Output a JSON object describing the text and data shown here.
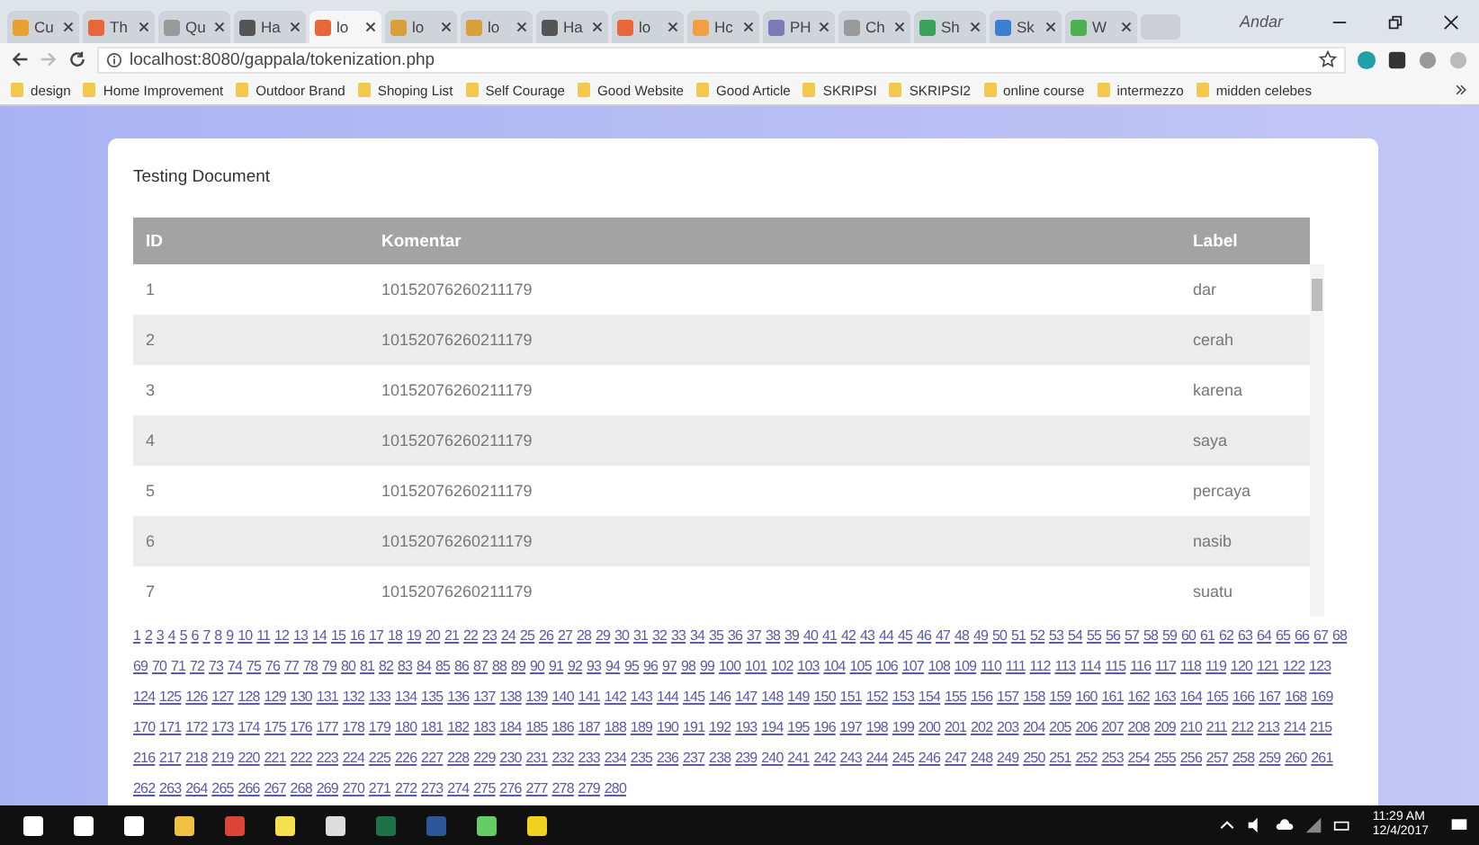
{
  "browser": {
    "user": "Andar",
    "tabs": [
      {
        "title": "Cu",
        "selected": false,
        "color": "#e8a030"
      },
      {
        "title": "Th",
        "selected": false,
        "color": "#e8663a"
      },
      {
        "title": "Qu",
        "selected": false,
        "color": "#9a9a9a"
      },
      {
        "title": "Ha",
        "selected": false,
        "color": "#555555"
      },
      {
        "title": "lo",
        "selected": true,
        "color": "#e8663a"
      },
      {
        "title": "lo",
        "selected": false,
        "color": "#d9a03a"
      },
      {
        "title": "lo",
        "selected": false,
        "color": "#d9a03a"
      },
      {
        "title": "Ha",
        "selected": false,
        "color": "#555555"
      },
      {
        "title": "lo",
        "selected": false,
        "color": "#e8663a"
      },
      {
        "title": "Hc",
        "selected": false,
        "color": "#f0a040"
      },
      {
        "title": "PH",
        "selected": false,
        "color": "#7a7ab8"
      },
      {
        "title": "Ch",
        "selected": false,
        "color": "#9a9a9a"
      },
      {
        "title": "Sh",
        "selected": false,
        "color": "#3aa05a"
      },
      {
        "title": "Sk",
        "selected": false,
        "color": "#3a80d0"
      },
      {
        "title": "W",
        "selected": false,
        "color": "#4caf50"
      }
    ],
    "address": "localhost:8080/gappala/tokenization.php",
    "bookmarks": [
      "design",
      "Home Improvement",
      "Outdoor Brand",
      "Shoping List",
      "Self Courage",
      "Good Website",
      "Good Article",
      "SKRIPSI",
      "SKRIPSI2",
      "online course",
      "intermezzo",
      "midden celebes"
    ]
  },
  "page": {
    "title": "Testing Document",
    "table": {
      "columns": [
        "ID",
        "Komentar",
        "Label"
      ],
      "rows": [
        [
          "1",
          "10152076260211179",
          "dar"
        ],
        [
          "2",
          "10152076260211179",
          "cerah"
        ],
        [
          "3",
          "10152076260211179",
          "karena"
        ],
        [
          "4",
          "10152076260211179",
          "saya"
        ],
        [
          "5",
          "10152076260211179",
          "percaya"
        ],
        [
          "6",
          "10152076260211179",
          "nasib"
        ],
        [
          "7",
          "10152076260211179",
          "suatu"
        ]
      ]
    },
    "pages": [
      "1",
      "2",
      "3",
      "4",
      "5",
      "6",
      "7",
      "8",
      "9",
      "10",
      "11",
      "12",
      "13",
      "14",
      "15",
      "16",
      "17",
      "18",
      "19",
      "20",
      "21",
      "22",
      "23",
      "24",
      "25",
      "26",
      "27",
      "28",
      "29",
      "30",
      "31",
      "32",
      "33",
      "34",
      "35",
      "36",
      "37",
      "38",
      "39",
      "40",
      "41",
      "42",
      "43",
      "44",
      "45",
      "46",
      "47",
      "48",
      "49",
      "50",
      "51",
      "52",
      "53",
      "54",
      "55",
      "56",
      "57",
      "58",
      "59",
      "60",
      "61",
      "62",
      "63",
      "64",
      "65",
      "66",
      "67",
      "68",
      "69",
      "70",
      "71",
      "72",
      "73",
      "74",
      "75",
      "76",
      "77",
      "78",
      "79",
      "80",
      "81",
      "82",
      "83",
      "84",
      "85",
      "86",
      "87",
      "88",
      "89",
      "90",
      "91",
      "92",
      "93",
      "94",
      "95",
      "96",
      "97",
      "98",
      "99",
      "100",
      "101",
      "102",
      "103",
      "104",
      "105",
      "106",
      "107",
      "108",
      "109",
      "110",
      "111",
      "112",
      "113",
      "114",
      "115",
      "116",
      "117",
      "118",
      "119",
      "120",
      "121",
      "122",
      "123",
      "124",
      "125",
      "126",
      "127",
      "128",
      "129",
      "130",
      "131",
      "132",
      "133",
      "134",
      "135",
      "136",
      "137",
      "138",
      "139",
      "140",
      "141",
      "142",
      "143",
      "144",
      "145",
      "146",
      "147",
      "148",
      "149",
      "150",
      "151",
      "152",
      "153",
      "154",
      "155",
      "156",
      "157",
      "158",
      "159",
      "160",
      "161",
      "162",
      "163",
      "164",
      "165",
      "166",
      "167",
      "168",
      "169",
      "170",
      "171",
      "172",
      "173",
      "174",
      "175",
      "176",
      "177",
      "178",
      "179",
      "180",
      "181",
      "182",
      "183",
      "184",
      "185",
      "186",
      "187",
      "188",
      "189",
      "190",
      "191",
      "192",
      "193",
      "194",
      "195",
      "196",
      "197",
      "198",
      "199",
      "200",
      "201",
      "202",
      "203",
      "204",
      "205",
      "206",
      "207",
      "208",
      "209",
      "210",
      "211",
      "212",
      "213",
      "214",
      "215",
      "216",
      "217",
      "218",
      "219",
      "220",
      "221",
      "222",
      "223",
      "224",
      "225",
      "226",
      "227",
      "228",
      "229",
      "230",
      "231",
      "232",
      "233",
      "234",
      "235",
      "236",
      "237",
      "238",
      "239",
      "240",
      "241",
      "242",
      "243",
      "244",
      "245",
      "246",
      "247",
      "248",
      "249",
      "250",
      "251",
      "252",
      "253",
      "254",
      "255",
      "256",
      "257",
      "258",
      "259",
      "260",
      "261",
      "262",
      "263",
      "264",
      "265",
      "266",
      "267",
      "268",
      "269",
      "270",
      "271",
      "272",
      "273",
      "274",
      "275",
      "276",
      "277",
      "278",
      "279",
      "280"
    ]
  },
  "taskbar": {
    "time": "11:29 AM",
    "date": "12/4/2017"
  }
}
